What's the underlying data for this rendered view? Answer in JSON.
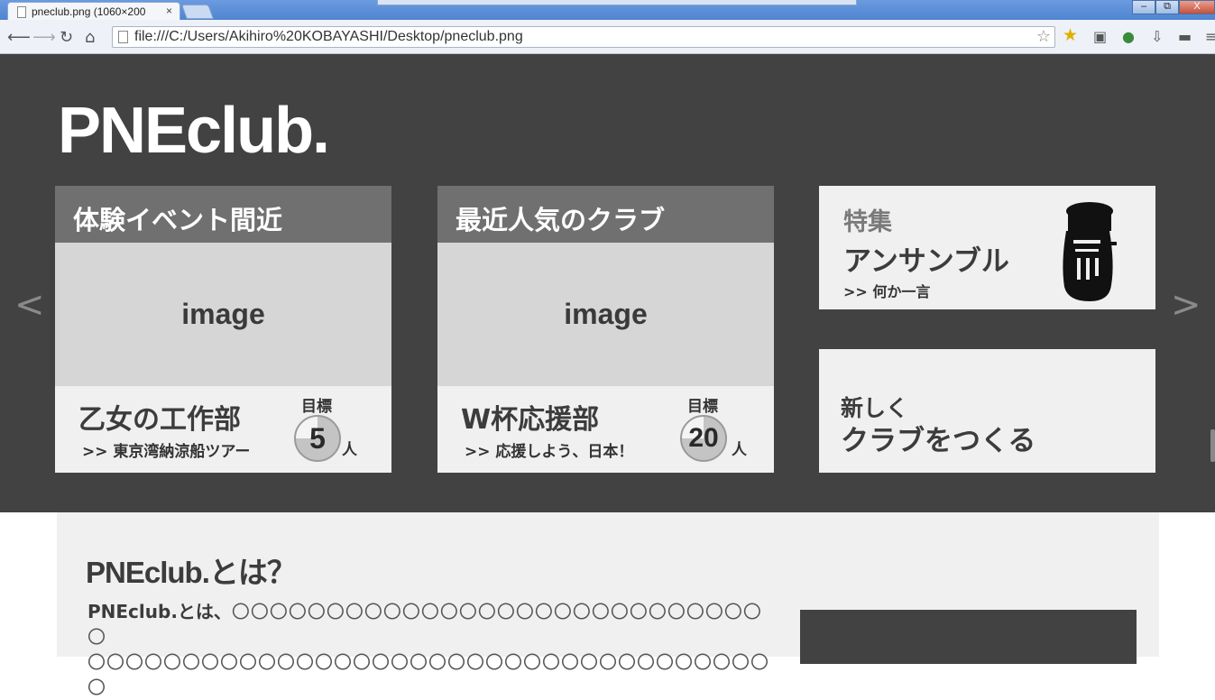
{
  "browser": {
    "tab_title": "pneclub.png (1060×200",
    "tab_close": "×",
    "url": "file:///C:/Users/Akihiro%20KOBAYASHI/Desktop/pneclub.png",
    "window_buttons": [
      "‒",
      "⧉",
      "X"
    ]
  },
  "page": {
    "logo": "PNEclub.",
    "nav": {
      "prev": "<",
      "next": ">"
    },
    "cards": [
      {
        "heading": "体験イベント間近",
        "image_label": "image",
        "club_name": "乙女の工作部",
        "subtitle": ">> 東京湾納涼船ツアー",
        "goal_label": "目標",
        "goal_number": "5",
        "goal_unit": "人"
      },
      {
        "heading": "最近人気のクラブ",
        "image_label": "image",
        "club_name": "W杯応援部",
        "subtitle": ">> 応援しよう、日本！",
        "goal_label": "目標",
        "goal_number": "20",
        "goal_unit": "人"
      }
    ],
    "feature": {
      "tag": "特集",
      "title": "アンサンブル",
      "subtitle": ">> 何か一言",
      "icon": "tuba-icon"
    },
    "create": {
      "line1": "新しく",
      "line2": "クラブをつくる"
    },
    "about": {
      "title": "PNEclub.とは？",
      "lead": "PNEclub.とは、",
      "line1_circles": "〇〇〇〇〇〇〇〇〇〇〇〇〇〇〇〇〇〇〇〇〇〇〇〇〇〇〇〇〇",
      "line2_circles": "〇〇〇〇〇〇〇〇〇〇〇〇〇〇〇〇〇〇〇〇〇〇〇〇〇〇〇〇〇〇〇〇〇〇〇〇〇"
    },
    "colors": {
      "hero_bg": "#424242",
      "card_header": "#707070",
      "image_placeholder": "#d6d6d6",
      "card_bg": "#f0f0f0"
    }
  }
}
